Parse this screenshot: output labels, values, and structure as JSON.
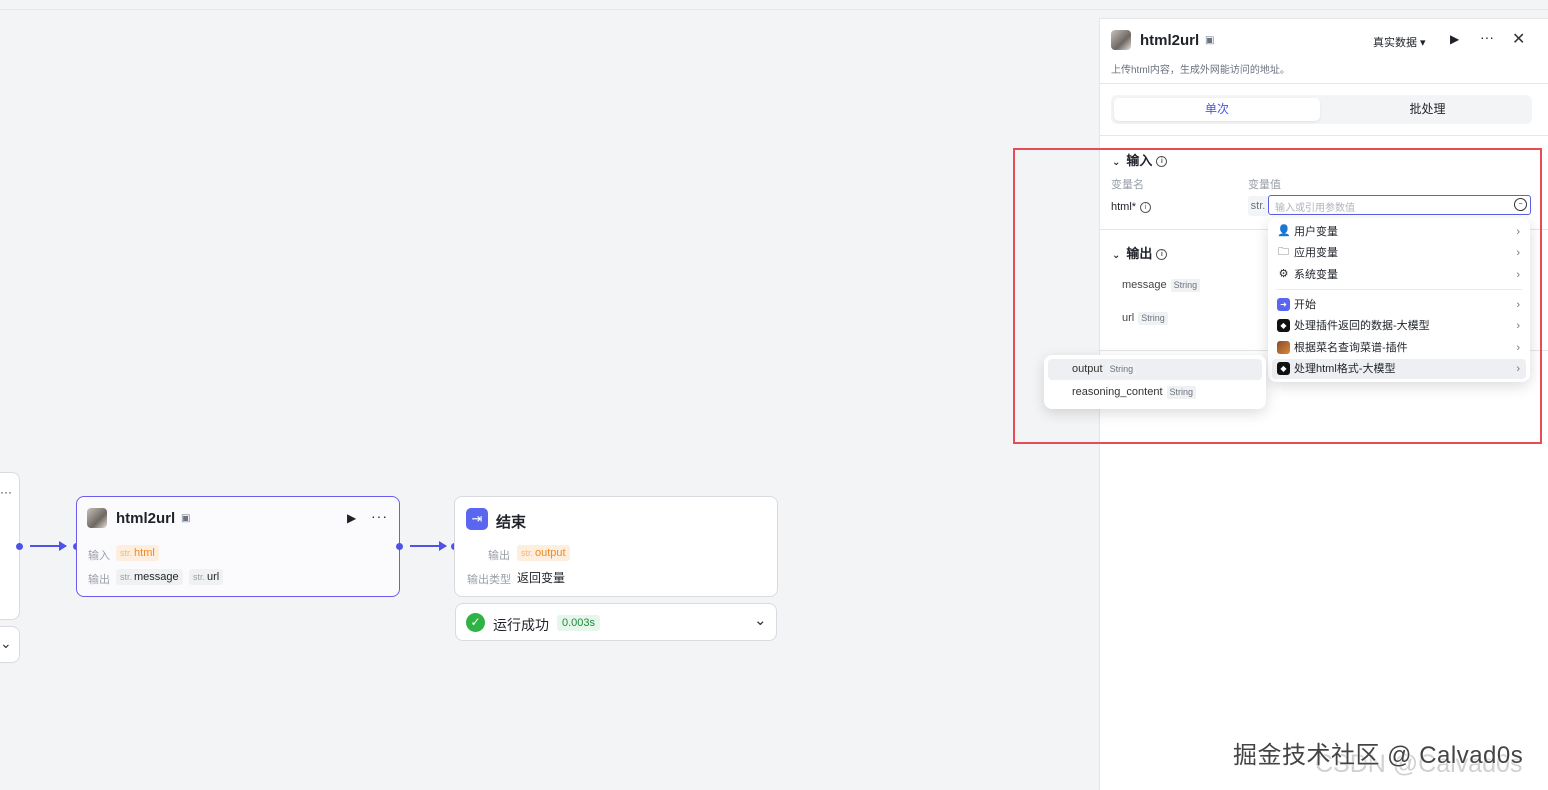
{
  "canvas": {
    "left_node": {
      "more": "···",
      "chevron": "⌄"
    },
    "html2url_node": {
      "title": "html2url",
      "input_label": "输入",
      "input_tag_prefix": "str.",
      "input_tag": "html",
      "output_label": "输出",
      "output_tags": [
        {
          "prefix": "str.",
          "name": "message"
        },
        {
          "prefix": "str.",
          "name": "url"
        }
      ]
    },
    "end_node": {
      "title": "结束",
      "output_label": "输出",
      "output_tag_prefix": "str.",
      "output_tag": "output",
      "output_type_label": "输出类型",
      "output_type_value": "返回变量"
    },
    "run_status": {
      "label": "运行成功",
      "time": "0.003s"
    }
  },
  "panel": {
    "title": "html2url",
    "data_mode": "真实数据 ▾",
    "description": "上传html内容，生成外网能访问的地址。",
    "tabs": [
      "单次",
      "批处理"
    ],
    "input_section": "输入",
    "col_name": "变量名",
    "col_value": "变量值",
    "param_name": "html*",
    "type_prefix": "str.",
    "value_placeholder": "输入或引用参数值",
    "output_section": "输出",
    "outputs": [
      {
        "name": "message",
        "type": "String"
      },
      {
        "name": "url",
        "type": "String"
      }
    ]
  },
  "ref_menu": {
    "items": [
      {
        "label": "用户变量",
        "icon": "user-icon"
      },
      {
        "label": "应用变量",
        "icon": "folder-icon"
      },
      {
        "label": "系统变量",
        "icon": "gear-icon"
      },
      {
        "label": "开始",
        "icon": "start-node-icon"
      },
      {
        "label": "处理插件返回的数据-大模型",
        "icon": "llm-node-icon"
      },
      {
        "label": "根据菜名查询菜谱-插件",
        "icon": "plugin-node-icon"
      },
      {
        "label": "处理html格式-大模型",
        "icon": "llm-node-icon"
      }
    ]
  },
  "sub_menu": {
    "items": [
      {
        "name": "output",
        "type": "String"
      },
      {
        "name": "reasoning_content",
        "type": "String"
      }
    ]
  },
  "watermark": {
    "main": "掘金技术社区 @ Calvad0s",
    "faint": "CSDN @Calvad0s"
  },
  "colors": {
    "accent": "#4d53e8",
    "highlight": "#e94b55",
    "success": "#2fb344"
  }
}
